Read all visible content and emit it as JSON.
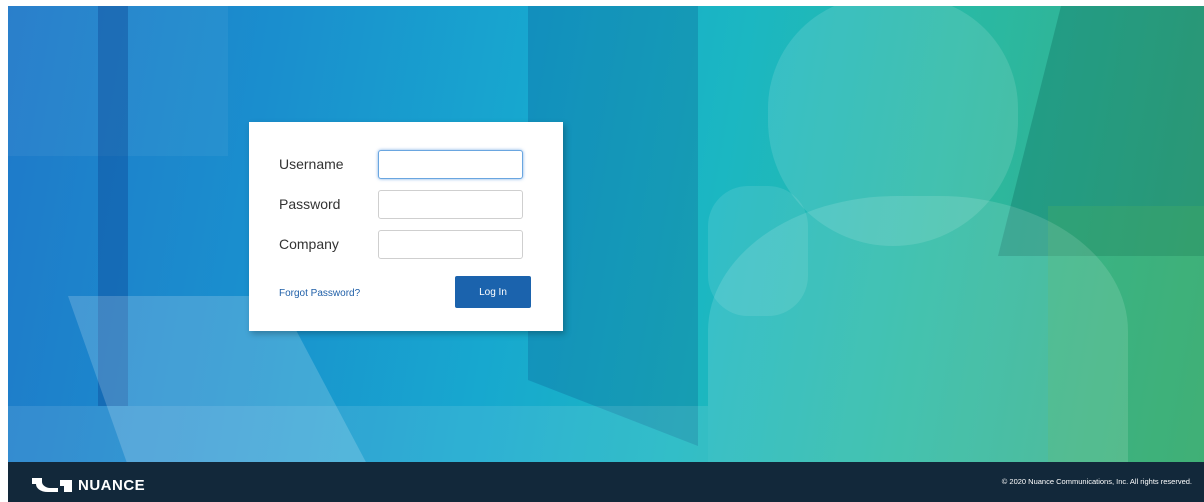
{
  "login": {
    "username_label": "Username",
    "username_value": "",
    "password_label": "Password",
    "password_value": "",
    "company_label": "Company",
    "company_value": "",
    "forgot_password": "Forgot Password?",
    "login_button": "Log In"
  },
  "footer": {
    "brand": "NUANCE",
    "brand_icon": "nuance-logo-icon",
    "copyright": "© 2020 Nuance Communications, Inc. All rights reserved."
  },
  "colors": {
    "button": "#1b63ad",
    "link": "#1f5fa8",
    "footer": "#12283a"
  }
}
